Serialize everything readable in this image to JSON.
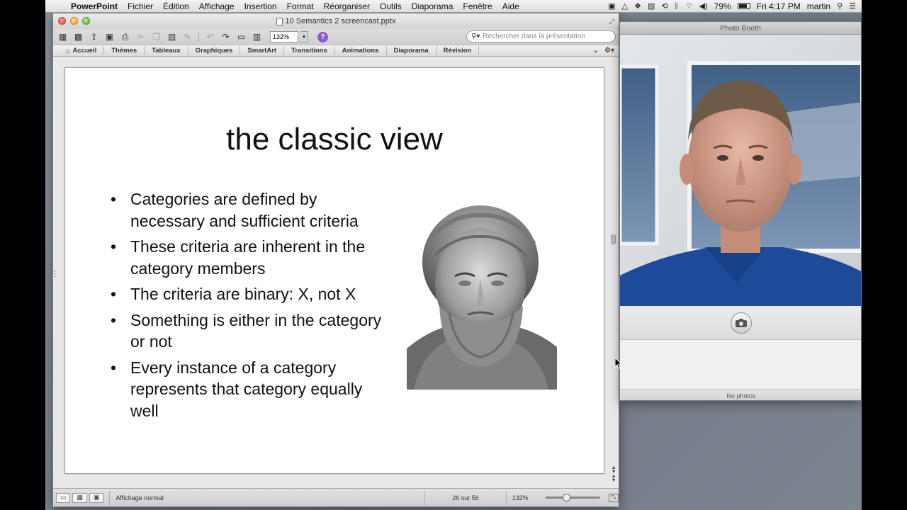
{
  "menubar": {
    "app_name": "PowerPoint",
    "menus": [
      "Fichier",
      "Édition",
      "Affichage",
      "Insertion",
      "Format",
      "Réorganiser",
      "Outils",
      "Diaporama",
      "Fenêtre",
      "Aide"
    ],
    "battery": "79%",
    "clock": "Fri 4:17 PM",
    "user": "martin"
  },
  "ppt": {
    "window_title": "10 Semantics 2 screencast.pptx",
    "zoom": "132%",
    "search_placeholder": "Rechercher dans la présentation",
    "ribbon_tabs": [
      "Accueil",
      "Thèmes",
      "Tableaux",
      "Graphiques",
      "SmartArt",
      "Transitions",
      "Animations",
      "Diaporama",
      "Révision"
    ],
    "slide": {
      "title": "the classic view",
      "bullets": [
        "Categories are defined by necessary and sufficient criteria",
        "These criteria are inherent in the category members",
        "The criteria are binary: X, not X",
        "Something is either in the category or not",
        "Every instance of a category represents that category equally well"
      ]
    },
    "status": {
      "view_mode": "Affichage normal",
      "page_count": "26 sur 56",
      "zoom": "132%"
    }
  },
  "photobooth": {
    "window_title": "Photo Booth",
    "footer": "No photos"
  }
}
